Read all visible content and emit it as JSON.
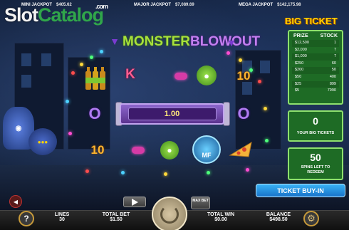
{
  "jackpots": [
    {
      "label": "MINI JACKPOT",
      "value": "$405.62"
    },
    {
      "label": "MAJOR JACKPOT",
      "value": "$7,089.69"
    },
    {
      "label": "MEGA JACKPOT",
      "value": "$142,175.98"
    }
  ],
  "watermark": {
    "brand_part1": "Slot",
    "brand_part2": "Catalog",
    "suffix": ".com"
  },
  "game_title": {
    "part1": "MONSTER",
    "part2": "BLOWOUT"
  },
  "multiplier": "1.00",
  "big_ticket": {
    "title": "BIG TICKET",
    "header": {
      "prize": "PRIZE",
      "stock": "STOCK"
    },
    "rows": [
      {
        "prize": "$12,500",
        "stock": "1"
      },
      {
        "prize": "$2,000",
        "stock": "7"
      },
      {
        "prize": "$1,000",
        "stock": "7"
      },
      {
        "prize": "$250",
        "stock": "60"
      },
      {
        "prize": "$200",
        "stock": "50"
      },
      {
        "prize": "$50",
        "stock": "400"
      },
      {
        "prize": "$25",
        "stock": "899"
      },
      {
        "prize": "$5",
        "stock": "7990"
      }
    ],
    "your_tickets": {
      "value": "0",
      "label": "YOUR BIG TICKETS"
    },
    "spins_left": {
      "value": "50",
      "label": "SPINS LEFT TO REDEEM"
    },
    "buy_button": "TICKET BUY-IN"
  },
  "symbols": {
    "k": "K",
    "ten": "10",
    "o": "O",
    "mf": "MF"
  },
  "bottom_bar": {
    "help": "?",
    "lines": {
      "label": "LINES",
      "value": "30"
    },
    "total_bet": {
      "label": "TOTAL BET",
      "value": "$1.50"
    },
    "max_bet": "MAX BET",
    "total_win": {
      "label": "TOTAL WIN",
      "value": "$0.00"
    },
    "balance": {
      "label": "BALANCE",
      "value": "$498.50"
    }
  },
  "colors": {
    "accent_green": "#1e6b25",
    "gold": "#ffd400",
    "button_blue": "#1873c9"
  }
}
